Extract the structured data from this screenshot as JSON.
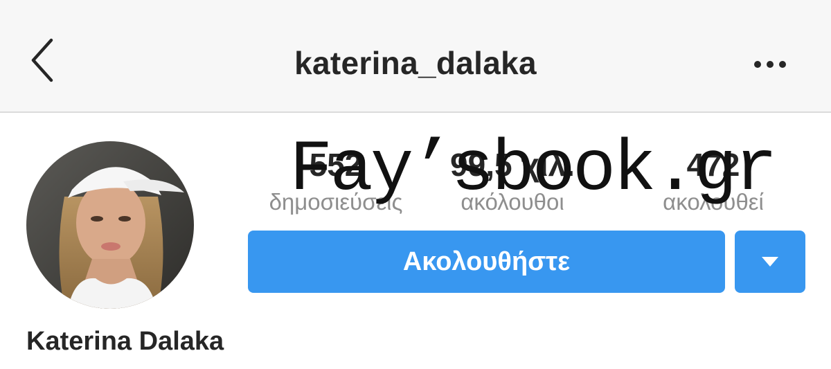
{
  "header": {
    "username": "katerina_dalaka",
    "back_icon": "chevron-left-icon",
    "more_icon": "more-horizontal-icon"
  },
  "profile": {
    "avatar": "profile-photo",
    "full_name": "Katerina Dalaka"
  },
  "stats": {
    "posts": {
      "value": "552",
      "label": "δημοσιεύσεις"
    },
    "followers": {
      "value": "99,5 χιλ.",
      "label": "ακόλουθοι"
    },
    "following": {
      "value": "472",
      "label": "ακολουθεί"
    }
  },
  "actions": {
    "follow_label": "Ακολουθήστε",
    "dropdown_icon": "triangle-down-icon"
  },
  "watermark": {
    "text": "Fay’sbook.gr"
  },
  "colors": {
    "accent": "#3897f0",
    "header_bg": "#f7f7f7",
    "text_primary": "#262626",
    "text_secondary": "#8e8e8e"
  }
}
